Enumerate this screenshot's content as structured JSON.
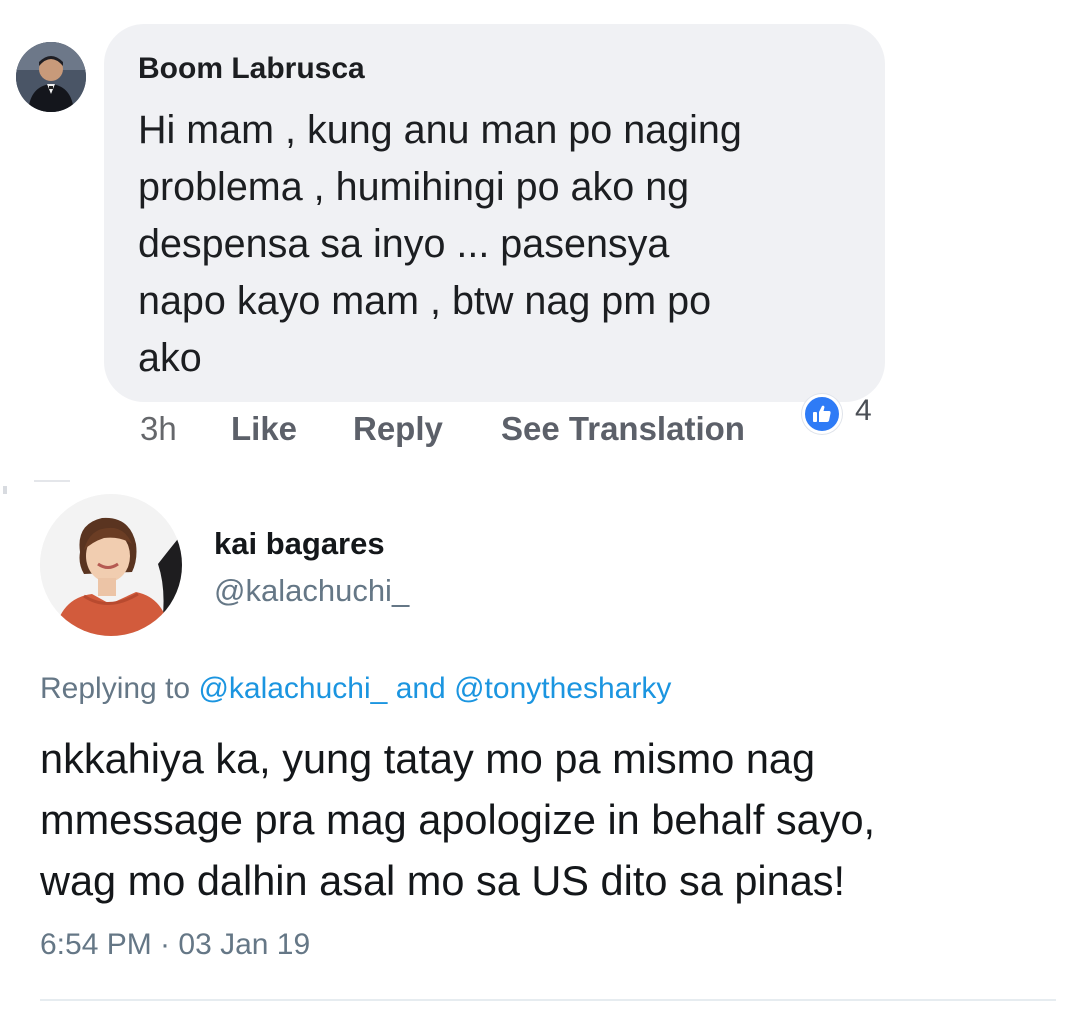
{
  "facebook_comment": {
    "author": "Boom Labrusca",
    "text_lines": [
      "Hi mam , kung anu man po naging",
      "problema , humihingi po ako ng",
      "despensa sa inyo ... pasensya",
      "napo kayo mam , btw nag pm po",
      "ako"
    ],
    "time": "3h",
    "like_label": "Like",
    "reply_label": "Reply",
    "translate_label": "See Translation",
    "reaction_icon": "thumbs-up-icon",
    "reaction_count": "4",
    "colors": {
      "bubble": "#f0f1f4",
      "like_reaction": "#2e7bf6"
    }
  },
  "tweet": {
    "display_name": "kai bagares",
    "handle": "@kalachuchi_",
    "replying_prefix": "Replying to",
    "replying_mention_1": "@kalachuchi_",
    "replying_joiner": "and",
    "replying_mention_2": "@tonythesharky",
    "text_lines": [
      "nkkahiya ka, yung tatay mo pa mismo nag",
      "mmessage pra mag apologize in behalf sayo,",
      "wag mo dalhin asal mo sa US dito sa pinas!"
    ],
    "timestamp": "6:54 PM · 03 Jan 19",
    "colors": {
      "link": "#1b95e0",
      "secondary_text": "#657786"
    }
  }
}
